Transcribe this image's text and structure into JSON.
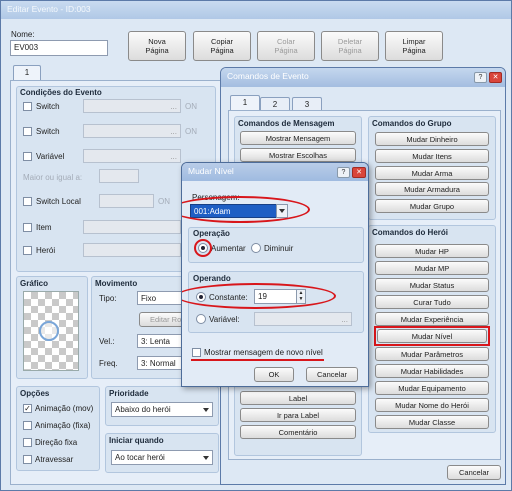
{
  "editor": {
    "title": "Editar Evento - ID:003",
    "name_label": "Nome:",
    "name_value": "EV003",
    "toolbar": {
      "new": "Nova\nPágina",
      "copy": "Copiar\nPágina",
      "paste": "Colar\nPágina",
      "delete": "Deletar\nPágina",
      "clear": "Limpar\nPágina"
    },
    "page_tab": "1",
    "conditions": {
      "title": "Condições do Evento",
      "switch1": "Switch",
      "switch2": "Switch",
      "variable": "Variável",
      "greater_equal": "Maior ou igual a:",
      "local_switch": "Switch Local",
      "item": "Item",
      "hero": "Herói",
      "on": "ON",
      "dots": "..."
    },
    "graphic_title": "Gráfico",
    "movement": {
      "title": "Movimento",
      "type_label": "Tipo:",
      "type_value": "Fixo",
      "edit_button": "Editar Rota",
      "speed_label": "Vel.:",
      "speed_value": "3: Lenta",
      "freq_label": "Freq.",
      "freq_value": "3: Normal"
    },
    "options": {
      "title": "Opções",
      "anim_move": "Animação (mov)",
      "anim_fixed": "Animação (fixa)",
      "dir_fixed": "Direção fixa",
      "pass_through": "Atravessar"
    },
    "priority": {
      "title": "Prioridade",
      "value": "Abaixo do herói"
    },
    "trigger": {
      "title": "Iniciar quando",
      "value": "Ao tocar herói"
    }
  },
  "commands": {
    "title": "Comandos de Evento",
    "help": "?",
    "close": "✕",
    "tabs": [
      "1",
      "2",
      "3"
    ],
    "message_group": {
      "title": "Comandos de Mensagem",
      "items": [
        "Mostrar Mensagem",
        "Mostrar Escolhas"
      ]
    },
    "group_group": {
      "title": "Comandos do Grupo",
      "items": [
        "Mudar Dinheiro",
        "Mudar Itens",
        "Mudar Arma",
        "Mudar Armadura",
        "Mudar Grupo"
      ]
    },
    "hero_group": {
      "title": "Comandos do Herói",
      "items": [
        "Mudar HP",
        "Mudar MP",
        "Mudar Status",
        "Curar Tudo",
        "Mudar Experiência",
        "Mudar Nível",
        "Mudar Parâmetros",
        "Mudar Habilidades",
        "Mudar Equipamento",
        "Mudar Nome do Herói",
        "Mudar Classe"
      ]
    },
    "flow_items": [
      "Label",
      "Ir para Label",
      "Comentário"
    ],
    "cancel": "Cancelar"
  },
  "dialog": {
    "title": "Mudar Nível",
    "help": "?",
    "close": "✕",
    "character_label": "Personagem:",
    "character_value": "001:Adam",
    "operation": {
      "title": "Operação",
      "increase": "Aumentar",
      "decrease": "Diminuir"
    },
    "operand": {
      "title": "Operando",
      "constant": "Constante:",
      "constant_value": "19",
      "variable": "Variável:",
      "dots": "..."
    },
    "show_message": "Mostrar mensagem de novo nível",
    "ok": "OK",
    "cancel": "Cancelar"
  },
  "colors": {
    "highlight": "#d8161b",
    "panel": "#d8e4f1",
    "window": "#dde8f4",
    "selection": "#1e5ec4"
  }
}
